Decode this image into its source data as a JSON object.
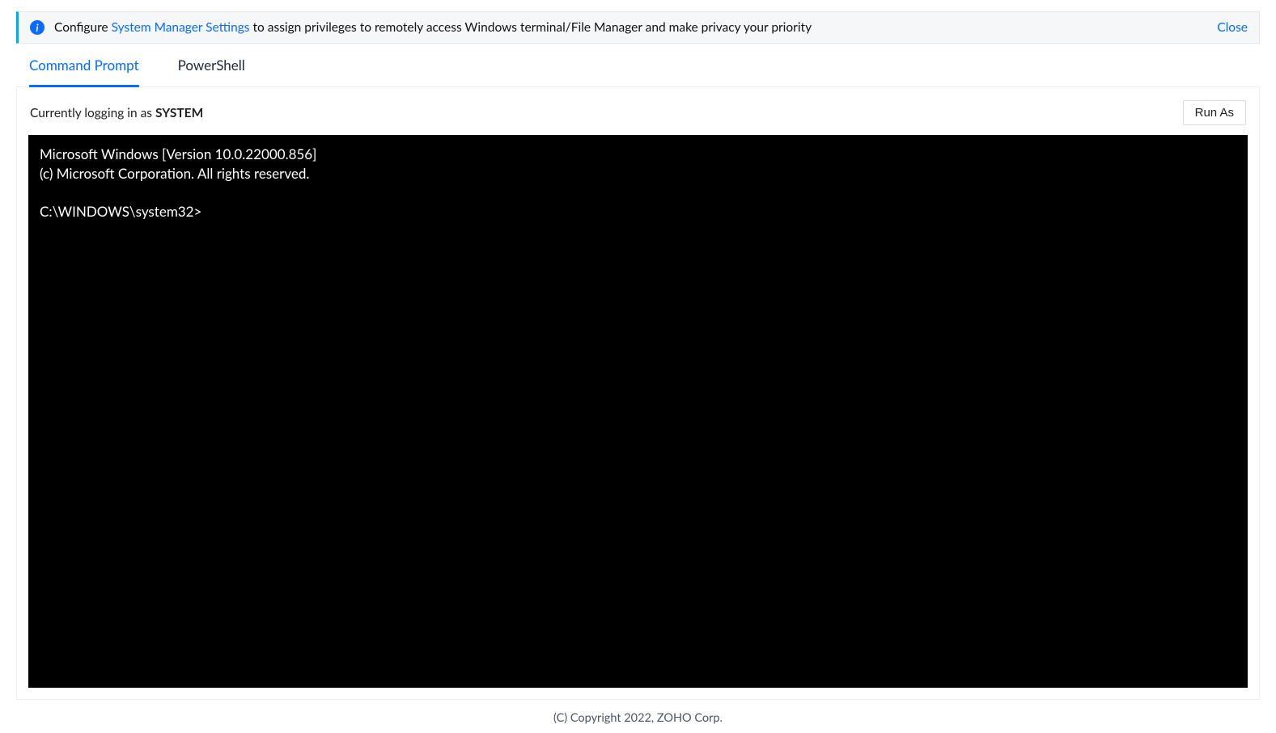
{
  "banner": {
    "prefix": "Configure ",
    "link_text": "System Manager Settings",
    "suffix": " to assign privileges to remotely access Windows terminal/File Manager and make privacy your priority",
    "close_label": "Close"
  },
  "tabs": {
    "cmd": "Command Prompt",
    "ps": "PowerShell"
  },
  "status": {
    "prefix": "Currently logging in as ",
    "user": "SYSTEM"
  },
  "buttons": {
    "run_as": "Run As"
  },
  "terminal": {
    "line1": "Microsoft Windows [Version 10.0.22000.856]",
    "line2": "(c) Microsoft Corporation. All rights reserved.",
    "prompt": "C:\\WINDOWS\\system32>"
  },
  "footer": {
    "copyright": "(C) Copyright 2022, ZOHO Corp."
  }
}
